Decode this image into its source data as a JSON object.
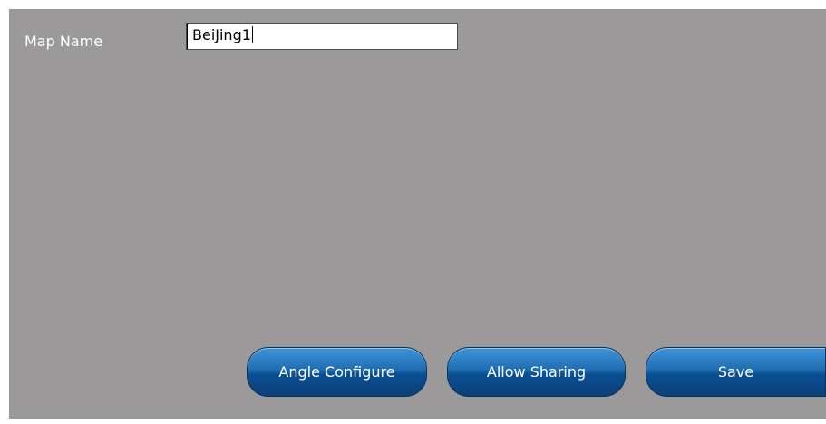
{
  "form": {
    "map_name_label": "Map Name",
    "map_name_value": "BeiJing1"
  },
  "actions": {
    "angle_configure_label": "Angle Configure",
    "allow_sharing_label": "Allow Sharing",
    "save_label": "Save"
  },
  "colors": {
    "panel_background": "#9b9999",
    "button_blue": "#1f6eb5",
    "button_text": "#ffffff"
  }
}
